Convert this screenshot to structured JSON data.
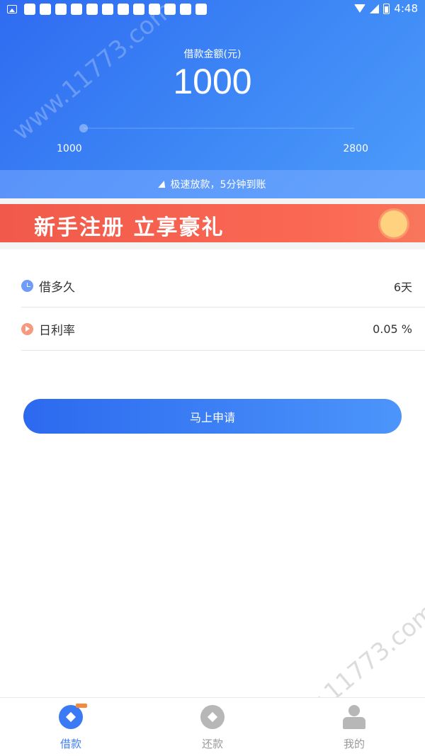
{
  "status_bar": {
    "time": "4:48",
    "icons": [
      "image-icon",
      "notification-icon",
      "wifi-icon",
      "signal-icon",
      "battery-icon"
    ]
  },
  "hero": {
    "amount_label": "借款金额(元)",
    "amount_value": "1000",
    "slider_min": "1000",
    "slider_max": "2800",
    "slider_level": 0,
    "fast_text": "极速放款，5分钟到账"
  },
  "promo": {
    "text": "新手注册 立享豪礼"
  },
  "details": [
    {
      "label": "借多久",
      "value": "6天",
      "icon": "clock-icon"
    },
    {
      "label": "日利率",
      "value": "0.05 %",
      "icon": "rate-icon"
    }
  ],
  "apply_button": "马上申请",
  "tabbar": [
    {
      "label": "借款",
      "icon": "borrow-icon",
      "active": true
    },
    {
      "label": "还款",
      "icon": "repay-icon",
      "active": false
    },
    {
      "label": "我的",
      "icon": "profile-icon",
      "active": false
    }
  ],
  "watermark": "www.11773.com",
  "colors": {
    "primary": "#3f7cf3",
    "promo": "#f15a4a",
    "inactive": "#999999"
  }
}
